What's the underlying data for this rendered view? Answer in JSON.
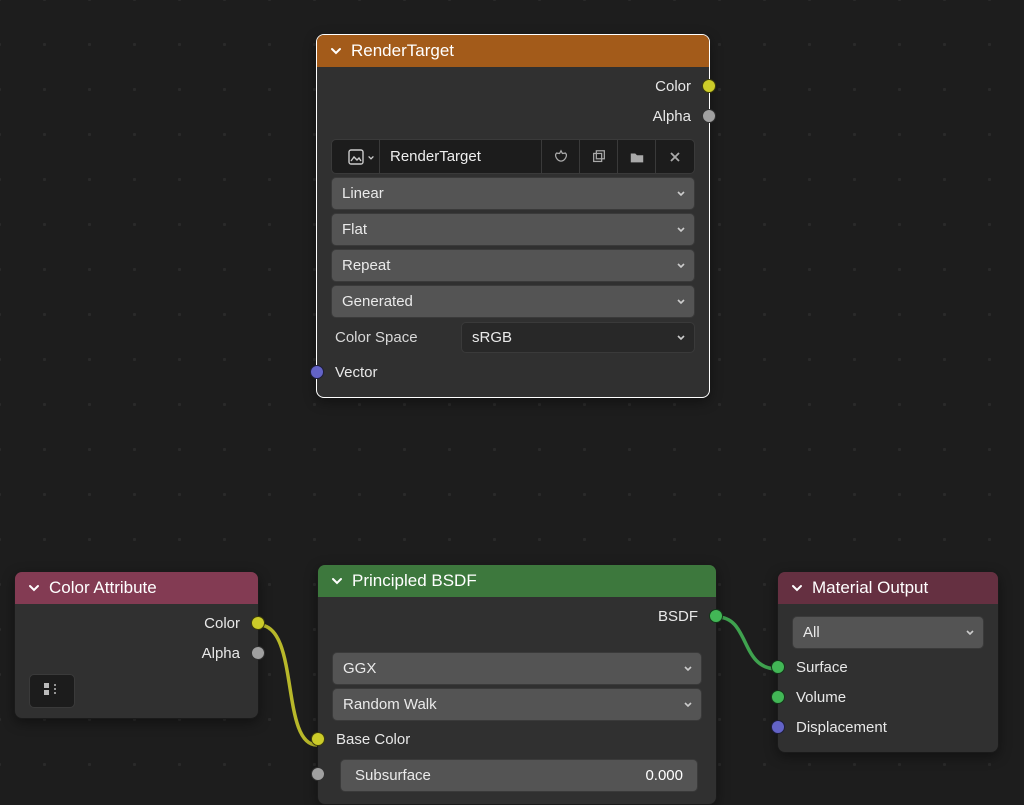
{
  "nodes": {
    "render_target": {
      "title": "RenderTarget",
      "outputs": {
        "color": "Color",
        "alpha": "Alpha"
      },
      "image_name": "RenderTarget",
      "interpolation": "Linear",
      "projection": "Flat",
      "extension": "Repeat",
      "source": "Generated",
      "colorspace_label": "Color Space",
      "colorspace_value": "sRGB",
      "inputs": {
        "vector": "Vector"
      }
    },
    "color_attribute": {
      "title": "Color Attribute",
      "outputs": {
        "color": "Color",
        "alpha": "Alpha"
      }
    },
    "principled": {
      "title": "Principled BSDF",
      "outputs": {
        "bsdf": "BSDF"
      },
      "distribution": "GGX",
      "subsurface_method": "Random Walk",
      "base_color_label": "Base Color",
      "subsurface_label": "Subsurface",
      "subsurface_value": "0.000"
    },
    "material_output": {
      "title": "Material Output",
      "target": "All",
      "inputs": {
        "surface": "Surface",
        "volume": "Volume",
        "displacement": "Displacement"
      }
    }
  }
}
